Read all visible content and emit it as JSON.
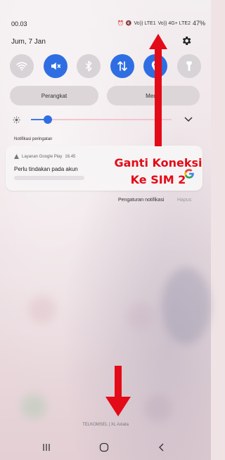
{
  "status_bar": {
    "time": "00.03",
    "sim1_label": "Vo)) LTE1",
    "sim2_label": "Vo)) 4G+ LTE2",
    "battery": "47%"
  },
  "header": {
    "date": "Jum, 7 Jan"
  },
  "quick_toggles": [
    {
      "name": "wifi",
      "active": false
    },
    {
      "name": "sound-mute",
      "active": true
    },
    {
      "name": "bluetooth",
      "active": false
    },
    {
      "name": "mobile-data",
      "active": true
    },
    {
      "name": "location",
      "active": true
    },
    {
      "name": "flashlight",
      "active": false
    }
  ],
  "buttons": {
    "perangkat": "Perangkat",
    "media": "Media"
  },
  "brightness": {
    "level": 0.12
  },
  "notifications": {
    "section_label": "Notifikasi peringatan",
    "items": [
      {
        "app": "Layanan Google Play",
        "time": "16.45",
        "title": "Perlu tindakan pada akun"
      }
    ],
    "settings_label": "Pengaturan notifikasi",
    "clear_label": "Hapus"
  },
  "annotation": {
    "line1": "Ganti Koneksi",
    "line2": "Ke SIM 2",
    "color": "#e30b17"
  },
  "carrier_text": "TELKOMSEL | XL Axiata"
}
